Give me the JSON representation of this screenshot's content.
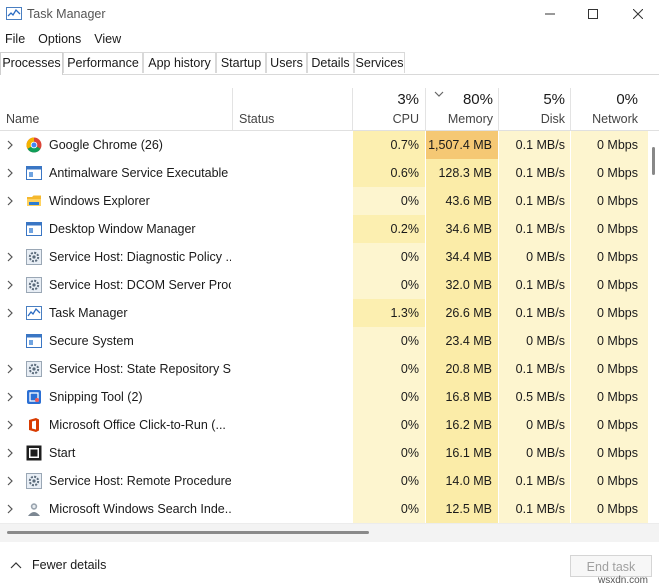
{
  "window": {
    "title": "Task Manager"
  },
  "menu": [
    "File",
    "Options",
    "View"
  ],
  "tabs": [
    "Processes",
    "Performance",
    "App history",
    "Startup",
    "Users",
    "Details",
    "Services"
  ],
  "active_tab": "Processes",
  "header": {
    "name": "Name",
    "status": "Status",
    "cpu_pct": "3%",
    "cpu": "CPU",
    "mem_pct": "80%",
    "mem": "Memory",
    "disk_pct": "5%",
    "disk": "Disk",
    "net_pct": "0%",
    "net": "Network"
  },
  "processes": [
    {
      "name": "Google Chrome (26)",
      "cpu": "0.7%",
      "mem": "1,507.4 MB",
      "disk": "0.1 MB/s",
      "net": "0 Mbps",
      "expandable": true,
      "icon": "chrome-icon"
    },
    {
      "name": "Antimalware Service Executable",
      "cpu": "0.6%",
      "mem": "128.3 MB",
      "disk": "0.1 MB/s",
      "net": "0 Mbps",
      "expandable": true,
      "icon": "service-window-icon"
    },
    {
      "name": "Windows Explorer",
      "cpu": "0%",
      "mem": "43.6 MB",
      "disk": "0.1 MB/s",
      "net": "0 Mbps",
      "expandable": true,
      "icon": "folder-icon"
    },
    {
      "name": "Desktop Window Manager",
      "cpu": "0.2%",
      "mem": "34.6 MB",
      "disk": "0.1 MB/s",
      "net": "0 Mbps",
      "expandable": false,
      "icon": "service-window-icon"
    },
    {
      "name": "Service Host: Diagnostic Policy ...",
      "cpu": "0%",
      "mem": "34.4 MB",
      "disk": "0 MB/s",
      "net": "0 Mbps",
      "expandable": true,
      "icon": "gear-icon"
    },
    {
      "name": "Service Host: DCOM Server Proc...",
      "cpu": "0%",
      "mem": "32.0 MB",
      "disk": "0.1 MB/s",
      "net": "0 Mbps",
      "expandable": true,
      "icon": "gear-icon"
    },
    {
      "name": "Task Manager",
      "cpu": "1.3%",
      "mem": "26.6 MB",
      "disk": "0.1 MB/s",
      "net": "0 Mbps",
      "expandable": true,
      "icon": "task-manager-icon"
    },
    {
      "name": "Secure System",
      "cpu": "0%",
      "mem": "23.4 MB",
      "disk": "0 MB/s",
      "net": "0 Mbps",
      "expandable": false,
      "icon": "service-window-icon"
    },
    {
      "name": "Service Host: State Repository S...",
      "cpu": "0%",
      "mem": "20.8 MB",
      "disk": "0.1 MB/s",
      "net": "0 Mbps",
      "expandable": true,
      "icon": "gear-icon"
    },
    {
      "name": "Snipping Tool (2)",
      "cpu": "0%",
      "mem": "16.8 MB",
      "disk": "0.5 MB/s",
      "net": "0 Mbps",
      "expandable": true,
      "icon": "snipping-tool-icon"
    },
    {
      "name": "Microsoft Office Click-to-Run (...",
      "cpu": "0%",
      "mem": "16.2 MB",
      "disk": "0 MB/s",
      "net": "0 Mbps",
      "expandable": true,
      "icon": "office-icon"
    },
    {
      "name": "Start",
      "cpu": "0%",
      "mem": "16.1 MB",
      "disk": "0 MB/s",
      "net": "0 Mbps",
      "expandable": true,
      "icon": "start-icon"
    },
    {
      "name": "Service Host: Remote Procedure...",
      "cpu": "0%",
      "mem": "14.0 MB",
      "disk": "0.1 MB/s",
      "net": "0 Mbps",
      "expandable": true,
      "icon": "gear-icon"
    },
    {
      "name": "Microsoft Windows Search Inde...",
      "cpu": "0%",
      "mem": "12.5 MB",
      "disk": "0.1 MB/s",
      "net": "0 Mbps",
      "expandable": true,
      "icon": "search-indexer-icon"
    }
  ],
  "footer": {
    "fewer_details": "Fewer details",
    "end_task": "End task"
  },
  "watermark": "wsxdn.com",
  "colors": {
    "cpu_light": "#fdf5cf",
    "cpu_mid": "#fcefb0",
    "mem_cell": "#fbeca8",
    "mem_hot": "#f5c874",
    "disk_cell": "#fdf5cf"
  }
}
